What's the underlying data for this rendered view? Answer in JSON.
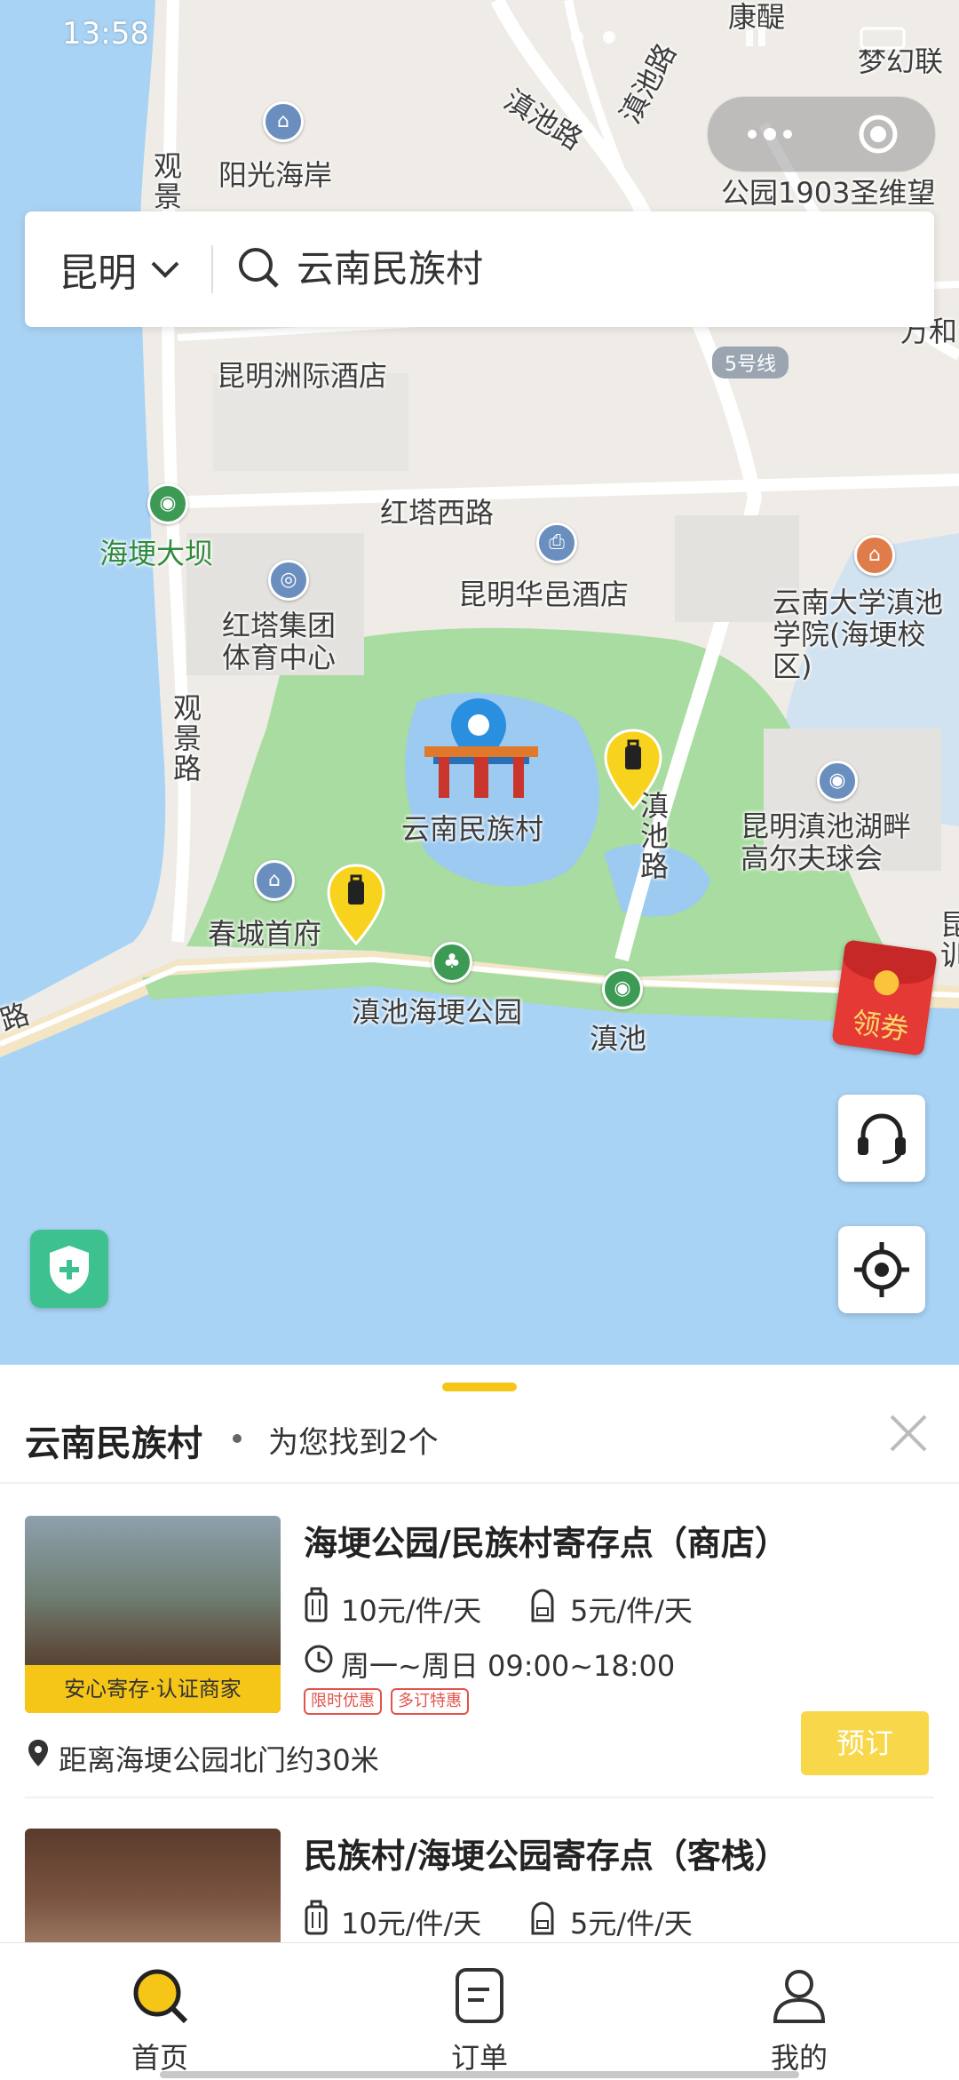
{
  "status_bar": {
    "time": "13:58"
  },
  "search": {
    "city": "昆明",
    "query": "云南民族村"
  },
  "map": {
    "labels": {
      "kangxing": "康醍",
      "menghuan": "梦幻联",
      "dianchi_road_top": "滇池路",
      "dianchi_road_top2": "滇池路",
      "yangguang": "阳光海岸",
      "gongyuan1903": "公园1903圣维望",
      "guanjing_top": "观景",
      "wanhe": "万和",
      "zhoujijiudian": "昆明洲际酒店",
      "line5": "5号线",
      "hongtaxilu": "红塔西路",
      "haigengdaba": "海埂大坝",
      "huayijiudian": "昆明华邑酒店",
      "yunda": "云南大学滇池学院(海埂校区)",
      "hongta_sports": "红塔集团体育中心",
      "guanjinglu": "观景路",
      "minzucun": "云南民族村",
      "dianchi_road_mid": "滇池路",
      "golf": "昆明滇池湖畔高尔夫球会",
      "chuncheng": "春城首府",
      "haigeng_park": "滇池海埂公园",
      "dianchi": "滇池",
      "road_left": "路",
      "right_edge": "昆训"
    },
    "coupon_label": "领券"
  },
  "sheet": {
    "title": "云南民族村",
    "result_text": "为您找到2个",
    "items": [
      {
        "name": "海埂公园/民族村寄存点（商店）",
        "price_large": "10元/件/天",
        "price_small": "5元/件/天",
        "hours": "周一~周日 09:00~18:00",
        "badge": "安心寄存·认证商家",
        "tags": [
          "限时优惠",
          "多订特惠"
        ],
        "distance": "距离海埂公园北门约30米",
        "book_label": "预订"
      },
      {
        "name": "民族村/海埂公园寄存点（客栈）",
        "price_large": "10元/件/天",
        "price_small": "5元/件/天"
      }
    ]
  },
  "nav": {
    "items": [
      {
        "label": "首页",
        "icon": "home-search-icon",
        "active": true
      },
      {
        "label": "订单",
        "icon": "order-icon",
        "active": false
      },
      {
        "label": "我的",
        "icon": "profile-icon",
        "active": false
      }
    ]
  },
  "colors": {
    "accent": "#f5c518",
    "water": "#a9d3f4",
    "green": "#9fd89a",
    "pin_blue": "#2b8fe0"
  }
}
